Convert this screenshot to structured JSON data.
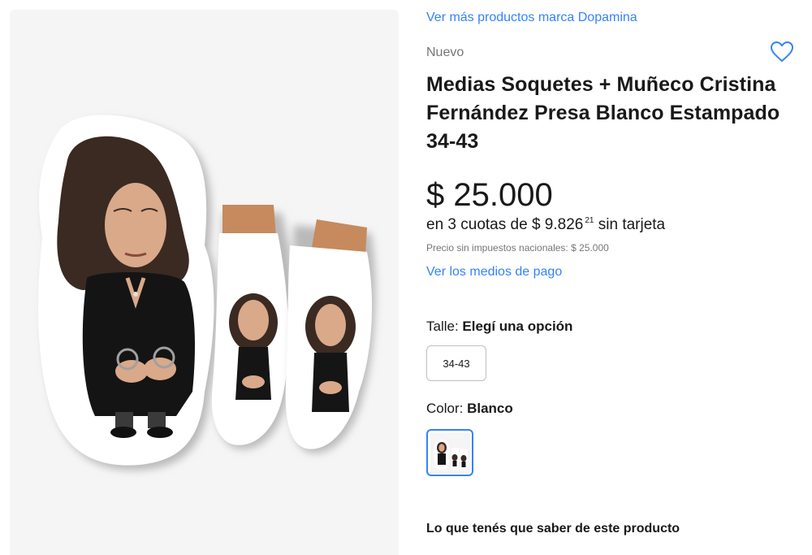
{
  "brand_link": "Ver más productos marca Dopamina",
  "condition": "Nuevo",
  "title": "Medias Soquetes + Muñeco Cristina Fernández Presa Blanco Estampado 34-43",
  "price": "$ 25.000",
  "installments": {
    "prefix": "en 3 cuotas de",
    "amount": "$ 9.826",
    "cents": "21",
    "suffix": "sin tarjeta"
  },
  "tax_note": "Precio sin impuestos nacionales: $ 25.000",
  "payment_link": "Ver los medios de pago",
  "size": {
    "label": "Talle:",
    "value": "Elegí una opción",
    "options": [
      "34-43"
    ]
  },
  "color": {
    "label": "Color:",
    "value": "Blanco"
  },
  "section_heading": "Lo que tenés que saber de este producto",
  "icons": {
    "favorite": "heart-outline-icon"
  },
  "colors": {
    "link": "#3483fa",
    "gallery_bg": "#f5f5f5"
  }
}
